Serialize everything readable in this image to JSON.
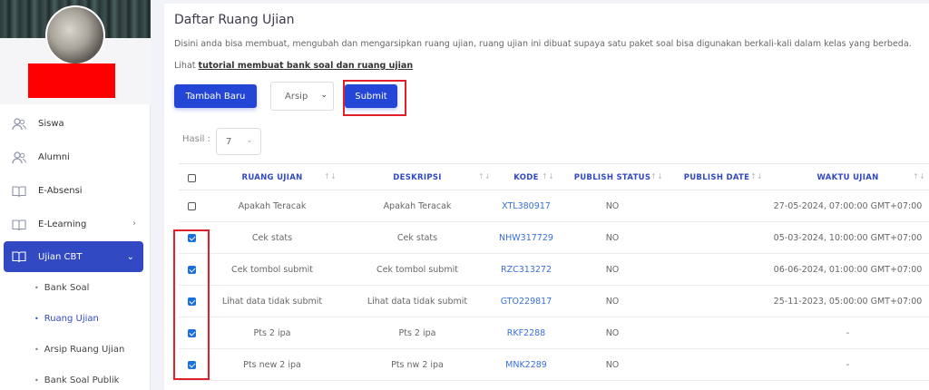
{
  "sidebar": {
    "items": [
      {
        "label": "Siswa",
        "icon": "users-icon"
      },
      {
        "label": "Alumni",
        "icon": "users-icon"
      },
      {
        "label": "E-Absensi",
        "icon": "book-icon"
      },
      {
        "label": "E-Learning",
        "icon": "book-icon",
        "chevron": "›"
      },
      {
        "label": "Ujian CBT",
        "icon": "book-icon",
        "chevron": "⌄",
        "active": true
      }
    ],
    "subitems": [
      {
        "label": "Bank Soal"
      },
      {
        "label": "Ruang Ujian",
        "current": true
      },
      {
        "label": "Arsip Ruang Ujian"
      },
      {
        "label": "Bank Soal Publik"
      }
    ]
  },
  "page": {
    "title": "Daftar Ruang Ujian",
    "description": "Disini anda bisa membuat, mengubah dan mengarsipkan ruang ujian, ruang ujian ini dibuat supaya satu paket soal bisa digunakan berkali-kali dalam kelas yang berbeda.",
    "tutorial_prefix": "Lihat",
    "tutorial_link": "tutorial membuat bank soal dan ruang ujian"
  },
  "toolbar": {
    "add_label": "Tambah Baru",
    "filter_value": "Arsip",
    "submit_label": "Submit"
  },
  "pagination": {
    "results_label": "Hasil :",
    "results_value": "7"
  },
  "table": {
    "columns": [
      "RUANG UJIAN",
      "DESKRIPSI",
      "KODE",
      "PUBLISH STATUS",
      "PUBLISH DATE",
      "WAKTU UJIAN"
    ],
    "sort_icon": "↑↓",
    "rows": [
      {
        "checked": false,
        "name": "Apakah Teracak",
        "desc": "Apakah Teracak",
        "code": "XTL380917",
        "status": "NO",
        "date": "",
        "time": "27-05-2024, 07:00:00 GMT+07:00"
      },
      {
        "checked": true,
        "name": "Cek stats",
        "desc": "Cek stats",
        "code": "NHW317729",
        "status": "NO",
        "date": "",
        "time": "05-03-2024, 10:00:00 GMT+07:00"
      },
      {
        "checked": true,
        "name": "Cek tombol submit",
        "desc": "Cek tombol submit",
        "code": "RZC313272",
        "status": "NO",
        "date": "",
        "time": "06-06-2024, 01:00:00 GMT+07:00"
      },
      {
        "checked": true,
        "name": "Lihat data tidak submit",
        "desc": "Lihat data tidak submit",
        "code": "GTO229817",
        "status": "NO",
        "date": "",
        "time": "25-11-2023, 05:00:00 GMT+07:00"
      },
      {
        "checked": true,
        "name": "Pts 2 ipa",
        "desc": "Pts 2 ipa",
        "code": "RKF2288",
        "status": "NO",
        "date": "",
        "time": "-"
      },
      {
        "checked": true,
        "name": "Pts new 2 ipa",
        "desc": "Pts nw 2 ipa",
        "code": "MNK2289",
        "status": "NO",
        "date": "",
        "time": "-"
      }
    ]
  },
  "colors": {
    "primary": "#2346d6",
    "sidebar_active": "#3249c4",
    "highlight_box": "#e0202a",
    "link": "#3a6fd8"
  }
}
